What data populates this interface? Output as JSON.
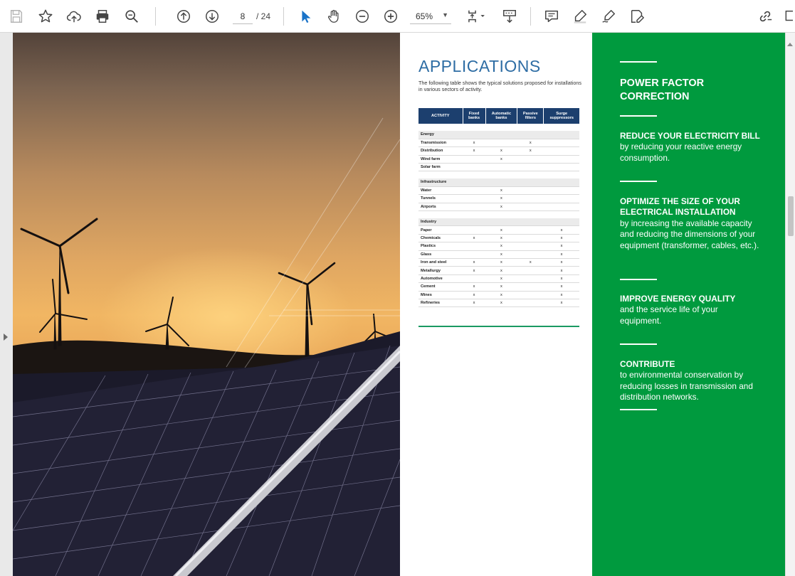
{
  "toolbar": {
    "current_page": "8",
    "total_pages": "/ 24",
    "zoom": "65%",
    "tools": [
      "save-icon",
      "bookmark-star-icon",
      "cloud-upload-icon",
      "print-icon",
      "zoom-search-icon",
      "page-up-icon",
      "page-down-icon",
      "select-cursor-icon",
      "hand-pan-icon",
      "zoom-out-icon",
      "zoom-in-icon",
      "fit-page-icon",
      "scroll-mode-icon",
      "comment-icon",
      "highlight-pen-icon",
      "draw-icon",
      "fill-sign-icon",
      "share-link-icon"
    ],
    "accent_color": "#1a73c8"
  },
  "applications": {
    "title": "APPLICATIONS",
    "intro": "The following table shows the typical solutions proposed for installations in various sectors of activity.",
    "columns": [
      "ACTIVITY",
      "Fixed banks",
      "Automatic banks",
      "Passive filters",
      "Surge suppressors"
    ],
    "sections": [
      {
        "name": "Energy",
        "rows": [
          {
            "activity": "Transmission",
            "marks": [
              "x",
              "",
              "x",
              ""
            ]
          },
          {
            "activity": "Distribution",
            "marks": [
              "x",
              "x",
              "x",
              ""
            ]
          },
          {
            "activity": "Wind farm",
            "marks": [
              "",
              "x",
              "",
              ""
            ]
          },
          {
            "activity": "Solar farm",
            "marks": [
              "",
              "",
              "",
              ""
            ]
          }
        ]
      },
      {
        "name": "Infrastructure",
        "rows": [
          {
            "activity": "Water",
            "marks": [
              "",
              "x",
              "",
              ""
            ]
          },
          {
            "activity": "Tunnels",
            "marks": [
              "",
              "x",
              "",
              ""
            ]
          },
          {
            "activity": "Airports",
            "marks": [
              "",
              "x",
              "",
              ""
            ]
          }
        ]
      },
      {
        "name": "Industry",
        "rows": [
          {
            "activity": "Paper",
            "marks": [
              "",
              "x",
              "",
              "x"
            ]
          },
          {
            "activity": "Chemicals",
            "marks": [
              "x",
              "x",
              "",
              "x"
            ]
          },
          {
            "activity": "Plastics",
            "marks": [
              "",
              "x",
              "",
              "x"
            ]
          },
          {
            "activity": "Glass",
            "marks": [
              "",
              "x",
              "",
              "x"
            ]
          },
          {
            "activity": "Iron and steel",
            "marks": [
              "x",
              "x",
              "x",
              "x"
            ]
          },
          {
            "activity": "Metallurgy",
            "marks": [
              "x",
              "x",
              "",
              "x"
            ]
          },
          {
            "activity": "Automotive",
            "marks": [
              "",
              "x",
              "",
              "x"
            ]
          },
          {
            "activity": "Cement",
            "marks": [
              "x",
              "x",
              "",
              "x"
            ]
          },
          {
            "activity": "Mines",
            "marks": [
              "x",
              "x",
              "",
              "x"
            ]
          },
          {
            "activity": "Refineries",
            "marks": [
              "x",
              "x",
              "",
              "x"
            ]
          }
        ]
      }
    ],
    "header_color": "#1c3f6e",
    "title_color": "#2e6da4"
  },
  "benefits": {
    "title": "POWER FACTOR CORRECTION",
    "background": "#009a3e",
    "items": [
      {
        "heading": "REDUCE YOUR ELECTRICITY BILL",
        "body": "by reducing your reactive energy consumption."
      },
      {
        "heading": "OPTIMIZE THE SIZE OF YOUR ELECTRICAL INSTALLATION",
        "body": "by increasing the available capacity and reducing the dimensions of your equipment (transformer, cables, etc.)."
      },
      {
        "heading": "IMPROVE ENERGY QUALITY",
        "body": "and the service life of your equipment."
      },
      {
        "heading": "CONTRIBUTE",
        "body": "to environmental conservation by reducing losses in transmission and distribution networks."
      }
    ]
  }
}
